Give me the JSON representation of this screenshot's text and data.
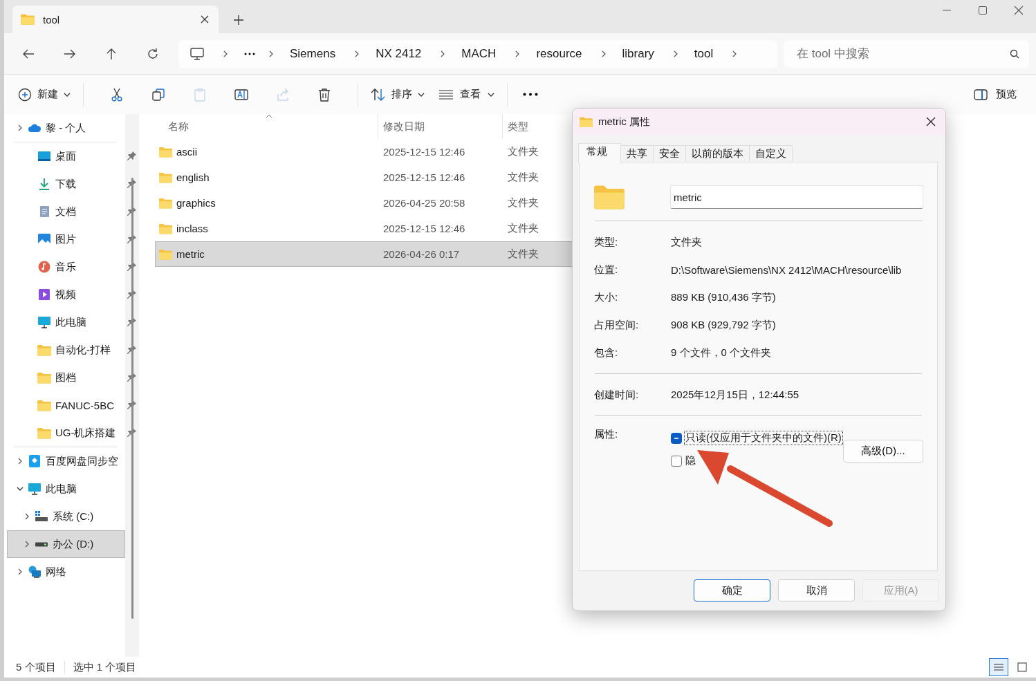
{
  "tab": {
    "title": "tool",
    "selected": true
  },
  "breadcrumb": [
    "Siemens",
    "NX 2412",
    "MACH",
    "resource",
    "library",
    "tool"
  ],
  "search": {
    "placeholder": "在 tool 中搜索"
  },
  "toolbar": {
    "new": "新建",
    "sort": "排序",
    "view": "查看",
    "preview": "预览"
  },
  "sidebar": {
    "top": [
      {
        "label": "黎 - 个人",
        "kind": "cloud",
        "expanded": false
      }
    ],
    "quick_access": [
      {
        "label": "桌面",
        "kind": "desktop",
        "pinned": true
      },
      {
        "label": "下载",
        "kind": "download",
        "pinned": true
      },
      {
        "label": "文档",
        "kind": "document",
        "pinned": true
      },
      {
        "label": "图片",
        "kind": "picture",
        "pinned": true
      },
      {
        "label": "音乐",
        "kind": "music",
        "pinned": true
      },
      {
        "label": "视频",
        "kind": "video",
        "pinned": true
      },
      {
        "label": "此电脑",
        "kind": "pc",
        "pinned": true
      },
      {
        "label": "自动化-打样",
        "kind": "folder",
        "pinned": true
      },
      {
        "label": "图档",
        "kind": "folder",
        "pinned": true
      },
      {
        "label": "FANUC-5BC",
        "kind": "folder",
        "pinned": true
      },
      {
        "label": "UG-机床搭建",
        "kind": "folder",
        "pinned": true
      }
    ],
    "tree": [
      {
        "label": "百度网盘同步空",
        "kind": "baidu",
        "expanded": false,
        "selected": false
      },
      {
        "label": "此电脑",
        "kind": "pc",
        "expanded": true,
        "selected": false,
        "children": [
          {
            "label": "系统 (C:)",
            "kind": "drive-c",
            "expanded": false,
            "selected": false
          },
          {
            "label": "办公 (D:)",
            "kind": "drive",
            "expanded": false,
            "selected": true
          }
        ]
      },
      {
        "label": "网络",
        "kind": "network",
        "expanded": false,
        "selected": false
      }
    ]
  },
  "file_list": {
    "columns": [
      "名称",
      "修改日期",
      "类型"
    ],
    "rows": [
      {
        "name": "ascii",
        "date": "2025-12-15 12:46",
        "type": "文件夹",
        "selected": false
      },
      {
        "name": "english",
        "date": "2025-12-15 12:46",
        "type": "文件夹",
        "selected": false
      },
      {
        "name": "graphics",
        "date": "2026-04-25 20:58",
        "type": "文件夹",
        "selected": false
      },
      {
        "name": "inclass",
        "date": "2025-12-15 12:46",
        "type": "文件夹",
        "selected": false
      },
      {
        "name": "metric",
        "date": "2026-04-26 0:17",
        "type": "文件夹",
        "selected": true
      }
    ]
  },
  "status_bar": {
    "items": [
      "5 个项目",
      "选中 1 个项目"
    ],
    "view_modes": [
      {
        "kind": "details",
        "selected": true
      },
      {
        "kind": "tiles",
        "selected": false
      }
    ]
  },
  "dialog": {
    "title": "metric 属性",
    "tabs": [
      {
        "label": "常规",
        "selected": true
      },
      {
        "label": "共享",
        "selected": false
      },
      {
        "label": "安全",
        "selected": false
      },
      {
        "label": "以前的版本",
        "selected": false
      },
      {
        "label": "自定义",
        "selected": false
      }
    ],
    "name": "metric",
    "groups": [
      [
        {
          "label": "类型:",
          "value": "文件夹"
        },
        {
          "label": "位置:",
          "value": "D:\\Software\\Siemens\\NX 2412\\MACH\\resource\\lib"
        },
        {
          "label": "大小:",
          "value": "889 KB (910,436 字节)"
        },
        {
          "label": "占用空间:",
          "value": "908 KB (929,792 字节)"
        },
        {
          "label": "包含:",
          "value": "9 个文件，0 个文件夹"
        }
      ],
      [
        {
          "label": "创建时间:",
          "value": "2025年12月15日，12:44:55"
        }
      ]
    ],
    "attributes_label": "属性:",
    "attributes": [
      {
        "label": "只读(仅应用于文件夹中的文件)(R)",
        "checked": false,
        "indeterminate": true,
        "focused": true
      },
      {
        "label": "隐",
        "checked": false,
        "indeterminate": false,
        "focused": false
      }
    ],
    "advanced": "高级(D)...",
    "buttons": [
      {
        "label": "确定",
        "kind": "default",
        "disabled": false
      },
      {
        "label": "取消",
        "kind": "normal",
        "disabled": false
      },
      {
        "label": "应用(A)",
        "kind": "normal",
        "disabled": true
      }
    ]
  }
}
